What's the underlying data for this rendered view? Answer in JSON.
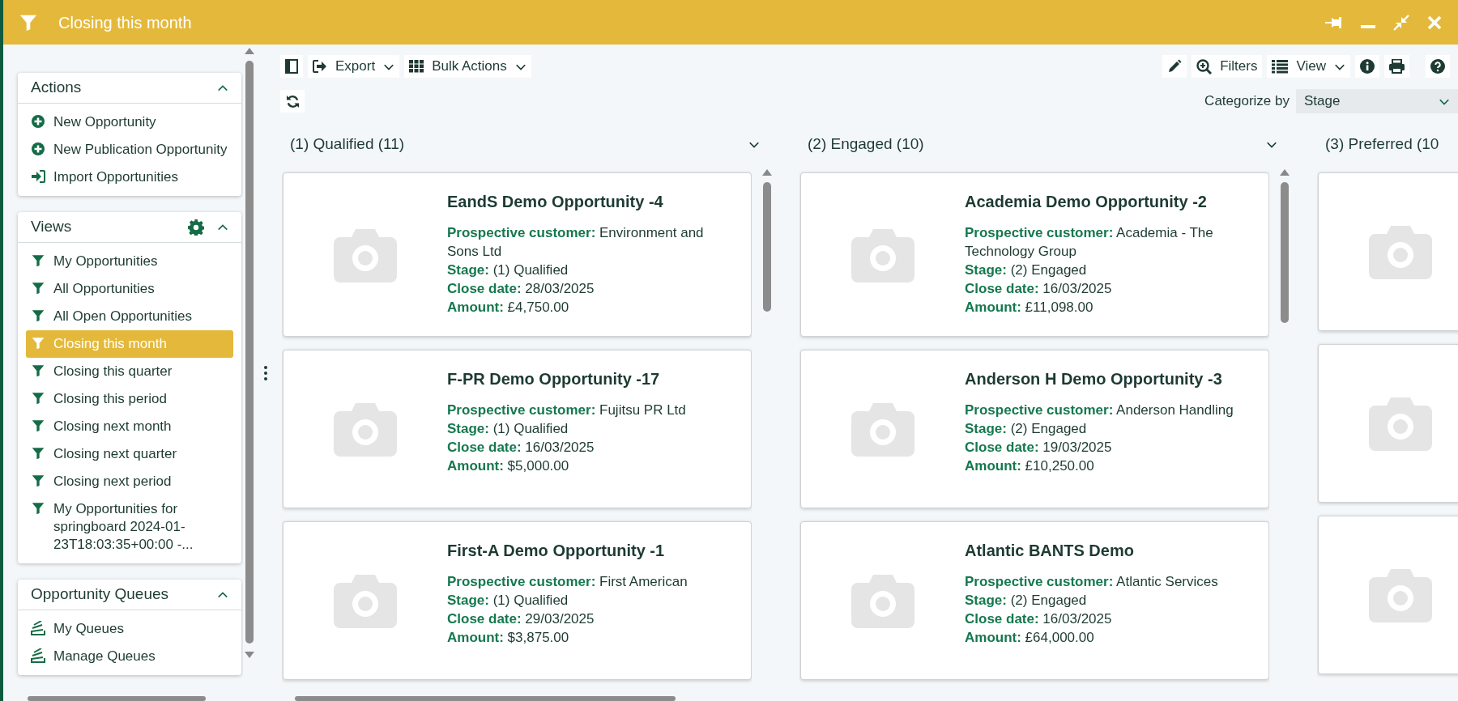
{
  "window": {
    "title": "Closing this month"
  },
  "sidebar": {
    "panels": [
      {
        "title": "Actions",
        "expanded": true,
        "has_settings": false,
        "items": [
          {
            "label": "New Opportunity",
            "kind": "add"
          },
          {
            "label": "New Publication Opportunity",
            "kind": "add"
          },
          {
            "label": "Import Opportunities",
            "kind": "import"
          }
        ]
      },
      {
        "title": "Views",
        "expanded": true,
        "has_settings": true,
        "items": [
          {
            "label": "My Opportunities",
            "kind": "filter",
            "selected": false
          },
          {
            "label": "All Opportunities",
            "kind": "filter",
            "selected": false
          },
          {
            "label": "All Open Opportunities",
            "kind": "filter",
            "selected": false
          },
          {
            "label": "Closing this month",
            "kind": "filter",
            "selected": true
          },
          {
            "label": "Closing this quarter",
            "kind": "filter",
            "selected": false
          },
          {
            "label": "Closing this period",
            "kind": "filter",
            "selected": false
          },
          {
            "label": "Closing next month",
            "kind": "filter",
            "selected": false
          },
          {
            "label": "Closing next quarter",
            "kind": "filter",
            "selected": false
          },
          {
            "label": "Closing next period",
            "kind": "filter",
            "selected": false
          },
          {
            "label": "My Opportunities for springboard 2024-01-23T18:03:35+00:00 -...",
            "kind": "filter",
            "selected": false
          }
        ]
      },
      {
        "title": "Opportunity Queues",
        "expanded": true,
        "has_settings": false,
        "items": [
          {
            "label": "My Queues",
            "kind": "queue"
          },
          {
            "label": "Manage Queues",
            "kind": "queue"
          }
        ]
      }
    ]
  },
  "toolbar": {
    "left": [
      {
        "kind": "panel"
      },
      {
        "kind": "export",
        "label": "Export",
        "dropdown": true
      },
      {
        "kind": "grid",
        "label": "Bulk Actions",
        "dropdown": true
      }
    ],
    "right": [
      {
        "kind": "edit"
      },
      {
        "kind": "zoom",
        "label": "Filters",
        "dropdown": false
      },
      {
        "kind": "list",
        "label": "View",
        "dropdown": true
      },
      {
        "kind": "info"
      },
      {
        "kind": "print"
      },
      {
        "kind": "help"
      }
    ]
  },
  "categorize": {
    "label": "Categorize by",
    "value": "Stage"
  },
  "columns": [
    {
      "title": "(1) Qualified (11)",
      "cards": [
        {
          "kind": "full",
          "title": "EandS Demo Opportunity -4",
          "fields": [
            {
              "label": "Prospective customer:",
              "value": "Environment and Sons Ltd"
            },
            {
              "label": "Stage:",
              "value": "(1) Qualified"
            },
            {
              "label": "Close date:",
              "value": "28/03/2025"
            },
            {
              "label": "Amount:",
              "value": "£4,750.00"
            }
          ]
        },
        {
          "kind": "full",
          "title": "F-PR Demo Opportunity -17",
          "fields": [
            {
              "label": "Prospective customer:",
              "value": "Fujitsu PR Ltd"
            },
            {
              "label": "Stage:",
              "value": "(1) Qualified"
            },
            {
              "label": "Close date:",
              "value": "16/03/2025"
            },
            {
              "label": "Amount:",
              "value": "$5,000.00"
            }
          ]
        },
        {
          "kind": "full",
          "title": "First-A Demo Opportunity -1",
          "fields": [
            {
              "label": "Prospective customer:",
              "value": "First American"
            },
            {
              "label": "Stage:",
              "value": "(1) Qualified"
            },
            {
              "label": "Close date:",
              "value": "29/03/2025"
            },
            {
              "label": "Amount:",
              "value": "$3,875.00"
            }
          ]
        }
      ]
    },
    {
      "title": "(2) Engaged (10)",
      "cards": [
        {
          "kind": "full",
          "title": "Academia Demo Opportunity -2",
          "fields": [
            {
              "label": "Prospective customer:",
              "value": "Academia - The Technology Group"
            },
            {
              "label": "Stage:",
              "value": "(2) Engaged"
            },
            {
              "label": "Close date:",
              "value": "16/03/2025"
            },
            {
              "label": "Amount:",
              "value": "£11,098.00"
            }
          ]
        },
        {
          "kind": "full",
          "title": "Anderson H Demo Opportunity -3",
          "fields": [
            {
              "label": "Prospective customer:",
              "value": "Anderson Handling"
            },
            {
              "label": "Stage:",
              "value": "(2) Engaged"
            },
            {
              "label": "Close date:",
              "value": "19/03/2025"
            },
            {
              "label": "Amount:",
              "value": "£10,250.00"
            }
          ]
        },
        {
          "kind": "full",
          "title": "Atlantic BANTS Demo",
          "fields": [
            {
              "label": "Prospective customer:",
              "value": "Atlantic Services"
            },
            {
              "label": "Stage:",
              "value": "(2) Engaged"
            },
            {
              "label": "Close date:",
              "value": "16/03/2025"
            },
            {
              "label": "Amount:",
              "value": "£64,000.00"
            }
          ]
        }
      ]
    },
    {
      "title": "(3) Preferred (10"
    }
  ]
}
